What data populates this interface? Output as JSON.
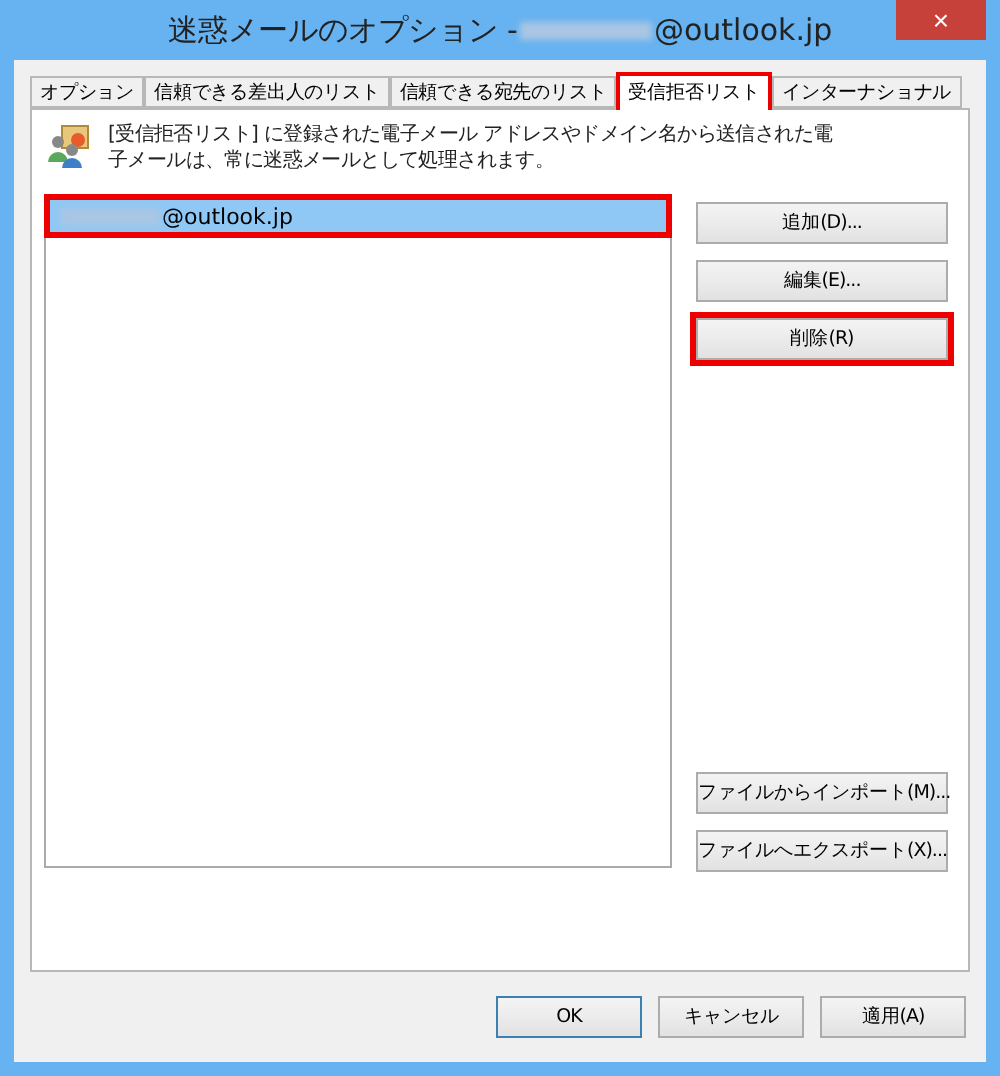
{
  "window": {
    "title_prefix": "迷惑メールのオプション - ",
    "title_suffix": "@outlook.jp",
    "close": "×"
  },
  "tabs": [
    {
      "label": "オプション",
      "selected": false,
      "highlighted": false
    },
    {
      "label": "信頼できる差出人のリスト",
      "selected": false,
      "highlighted": false
    },
    {
      "label": "信頼できる宛先のリスト",
      "selected": false,
      "highlighted": false
    },
    {
      "label": "受信拒否リスト",
      "selected": true,
      "highlighted": true
    },
    {
      "label": "インターナショナル",
      "selected": false,
      "highlighted": false
    }
  ],
  "description": "[受信拒否リスト] に登録された電子メール アドレスやドメイン名から送信された電子メールは、常に迷惑メールとして処理されます。",
  "list": [
    {
      "suffix": "@outlook.jp",
      "selected": true,
      "highlighted": true
    }
  ],
  "side_buttons_top": [
    {
      "label": "追加(D)...",
      "highlighted": false
    },
    {
      "label": "編集(E)...",
      "highlighted": false
    },
    {
      "label": "削除(R)",
      "highlighted": true
    }
  ],
  "side_buttons_bottom": [
    {
      "label": "ファイルからインポート(M)...",
      "highlighted": false
    },
    {
      "label": "ファイルへエクスポート(X)...",
      "highlighted": false
    }
  ],
  "footer_buttons": [
    {
      "label": "OK",
      "default": true
    },
    {
      "label": "キャンセル",
      "default": false
    },
    {
      "label": "適用(A)",
      "default": false
    }
  ]
}
